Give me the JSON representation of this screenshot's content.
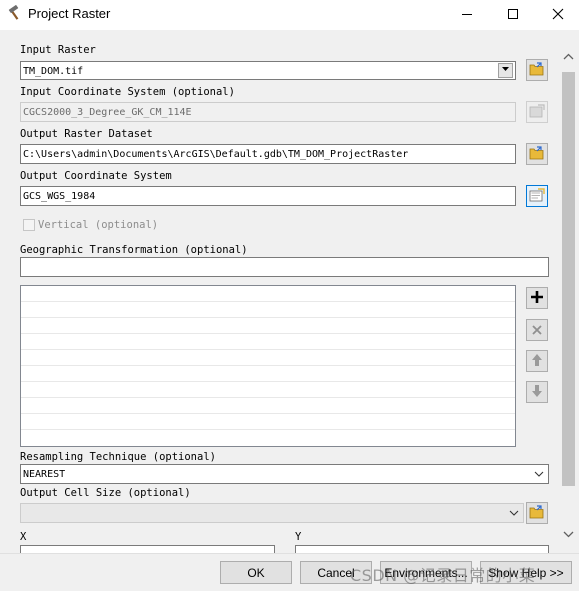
{
  "window": {
    "title": "Project Raster"
  },
  "form": {
    "input_raster": {
      "label": "Input Raster",
      "value": "TM_DOM.tif"
    },
    "input_coordinate_system": {
      "label": "Input Coordinate System (optional)",
      "value": "CGCS2000_3_Degree_GK_CM_114E"
    },
    "output_raster_dataset": {
      "label": "Output Raster Dataset",
      "value": "C:\\Users\\admin\\Documents\\ArcGIS\\Default.gdb\\TM_DOM_ProjectRaster"
    },
    "output_coordinate_system": {
      "label": "Output Coordinate System",
      "value": "GCS_WGS_1984"
    },
    "vertical": {
      "label": "Vertical (optional)",
      "checked": false
    },
    "geographic_transformation": {
      "label": "Geographic Transformation (optional)",
      "value": ""
    },
    "resampling_technique": {
      "label": "Resampling Technique (optional)",
      "value": "NEAREST"
    },
    "output_cell_size": {
      "label": "Output Cell Size (optional)",
      "value": ""
    },
    "cell_x": {
      "label": "X"
    },
    "cell_y": {
      "label": "Y"
    }
  },
  "buttons": {
    "ok": "OK",
    "cancel": "Cancel",
    "environments": "Environments...",
    "show_help": "Show Help >>"
  },
  "watermark": "CSDN @记录日常的小菜",
  "colors": {
    "accent": "#0078d7",
    "folder_yellow": "#e8b93a",
    "plus_black": "#000000",
    "disabled_gray": "#9a9a9a"
  },
  "icons": {
    "app": "hammer-icon",
    "minimize": "minimize-icon",
    "maximize": "maximize-icon",
    "close": "close-icon",
    "browse": "folder-icon",
    "coordinate": "coordinate-system-icon",
    "add": "plus-icon",
    "remove": "x-icon",
    "up": "arrow-up-icon",
    "down": "arrow-down-icon"
  }
}
